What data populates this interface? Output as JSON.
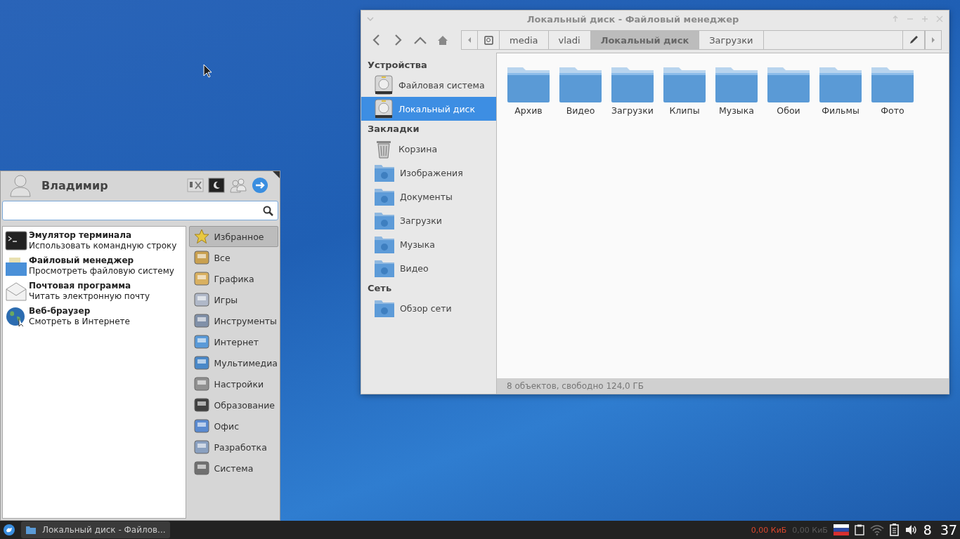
{
  "file_manager": {
    "title": "Локальный диск - Файловый менеджер",
    "path_buttons": [
      {
        "label": "media",
        "selected": false
      },
      {
        "label": "vladi",
        "selected": false
      },
      {
        "label": "Локальный диск",
        "selected": true
      },
      {
        "label": "Загрузки",
        "selected": false
      }
    ],
    "sidebar": [
      {
        "title": "Устройства",
        "items": [
          {
            "label": "Файловая система",
            "kind": "disk",
            "selected": false
          },
          {
            "label": "Локальный диск",
            "kind": "disk",
            "selected": true
          }
        ]
      },
      {
        "title": "Закладки",
        "items": [
          {
            "label": "Корзина",
            "kind": "trash",
            "selected": false
          },
          {
            "label": "Изображения",
            "kind": "folder",
            "selected": false
          },
          {
            "label": "Документы",
            "kind": "folder",
            "selected": false
          },
          {
            "label": "Загрузки",
            "kind": "folder",
            "selected": false
          },
          {
            "label": "Музыка",
            "kind": "folder",
            "selected": false
          },
          {
            "label": "Видео",
            "kind": "folder",
            "selected": false
          }
        ]
      },
      {
        "title": "Сеть",
        "items": [
          {
            "label": "Обзор сети",
            "kind": "folder",
            "selected": false
          }
        ]
      }
    ],
    "files": [
      {
        "label": "Архив"
      },
      {
        "label": "Видео"
      },
      {
        "label": "Загрузки"
      },
      {
        "label": "Клипы"
      },
      {
        "label": "Музыка"
      },
      {
        "label": "Обои"
      },
      {
        "label": "Фильмы"
      },
      {
        "label": "Фото"
      }
    ],
    "status": "8 объектов, свободно 124,0 ГБ"
  },
  "app_menu": {
    "user_name": "Владимир",
    "favorites": [
      {
        "name": "Эмулятор терминала",
        "description": "Использовать командную строку",
        "kind": "terminal"
      },
      {
        "name": "Файловый менеджер",
        "description": "Просмотреть файловую систему",
        "kind": "files"
      },
      {
        "name": "Почтовая программа",
        "description": "Читать электронную почту",
        "kind": "mail"
      },
      {
        "name": "Веб-браузер",
        "description": "Смотреть в Интернете",
        "kind": "web"
      }
    ],
    "categories": [
      {
        "label": "Избранное",
        "selected": true
      },
      {
        "label": "Все",
        "selected": false
      },
      {
        "label": "Графика",
        "selected": false
      },
      {
        "label": "Игры",
        "selected": false
      },
      {
        "label": "Инструменты",
        "selected": false
      },
      {
        "label": "Интернет",
        "selected": false
      },
      {
        "label": "Мультимедиа",
        "selected": false
      },
      {
        "label": "Настройки",
        "selected": false
      },
      {
        "label": "Образование",
        "selected": false
      },
      {
        "label": "Офис",
        "selected": false
      },
      {
        "label": "Разработка",
        "selected": false
      },
      {
        "label": "Система",
        "selected": false
      }
    ]
  },
  "taskbar": {
    "tasks": [
      {
        "label": "Локальный диск - Файлов..."
      }
    ],
    "net_speeds": [
      {
        "text": "0,00 КиБ",
        "color": "#d9462c"
      },
      {
        "text": "0,00 КиБ",
        "color": "#5a5a5a"
      }
    ],
    "clock": "8 37"
  }
}
